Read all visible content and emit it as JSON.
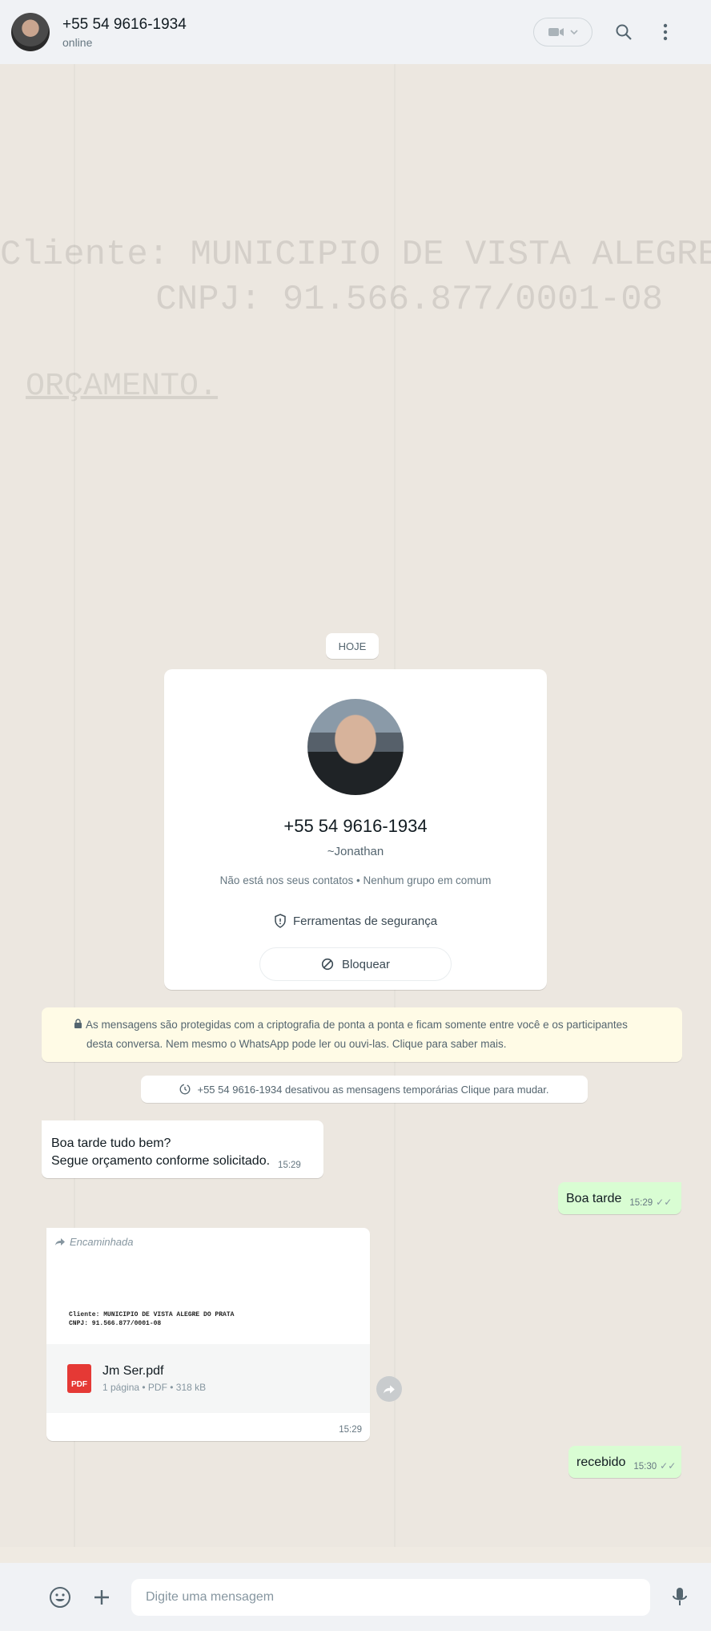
{
  "header": {
    "title": "+55 54 9616-1934",
    "status": "online"
  },
  "background": {
    "doc_line1": "Cliente: MUNICIPIO DE VISTA ALEGRE",
    "doc_line2": "CNPJ: 91.566.877/0001-08",
    "doc_orc": "ORÇAMENTO."
  },
  "date_chip": "HOJE",
  "contact_card": {
    "name": "+55 54 9616-1934",
    "alias": "~Jonathan",
    "info": "Não está nos seus contatos • Nenhum grupo em comum",
    "tools_label": "Ferramentas de segurança",
    "block_label": "Bloquear"
  },
  "e2e_notice": "As mensagens são protegidas com a criptografia de ponta a ponta e ficam somente entre você e os participantes desta conversa. Nem mesmo o WhatsApp pode ler ou ouvi-las. Clique para saber mais.",
  "system_notice": "+55 54 9616-1934 desativou as mensagens temporárias Clique para mudar.",
  "messages": [
    {
      "direction": "in",
      "text": "Boa tarde tudo bem?\nSegue orçamento conforme solicitado.",
      "time": "15:29"
    },
    {
      "direction": "out",
      "text": "Boa tarde",
      "time": "15:29"
    },
    {
      "direction": "in",
      "forwarded_label": "Encaminhada",
      "preview_line1": "Cliente: MUNICIPIO DE VISTA ALEGRE DO PRATA",
      "preview_line2": "CNPJ: 91.566.877/0001-08",
      "file_name": "Jm Ser.pdf",
      "file_meta": "1 página • PDF • 318 kB",
      "file_badge": "PDF",
      "time": "15:29"
    },
    {
      "direction": "out",
      "text": "recebido",
      "time": "15:30"
    }
  ],
  "composer": {
    "placeholder": "Digite uma mensagem"
  }
}
